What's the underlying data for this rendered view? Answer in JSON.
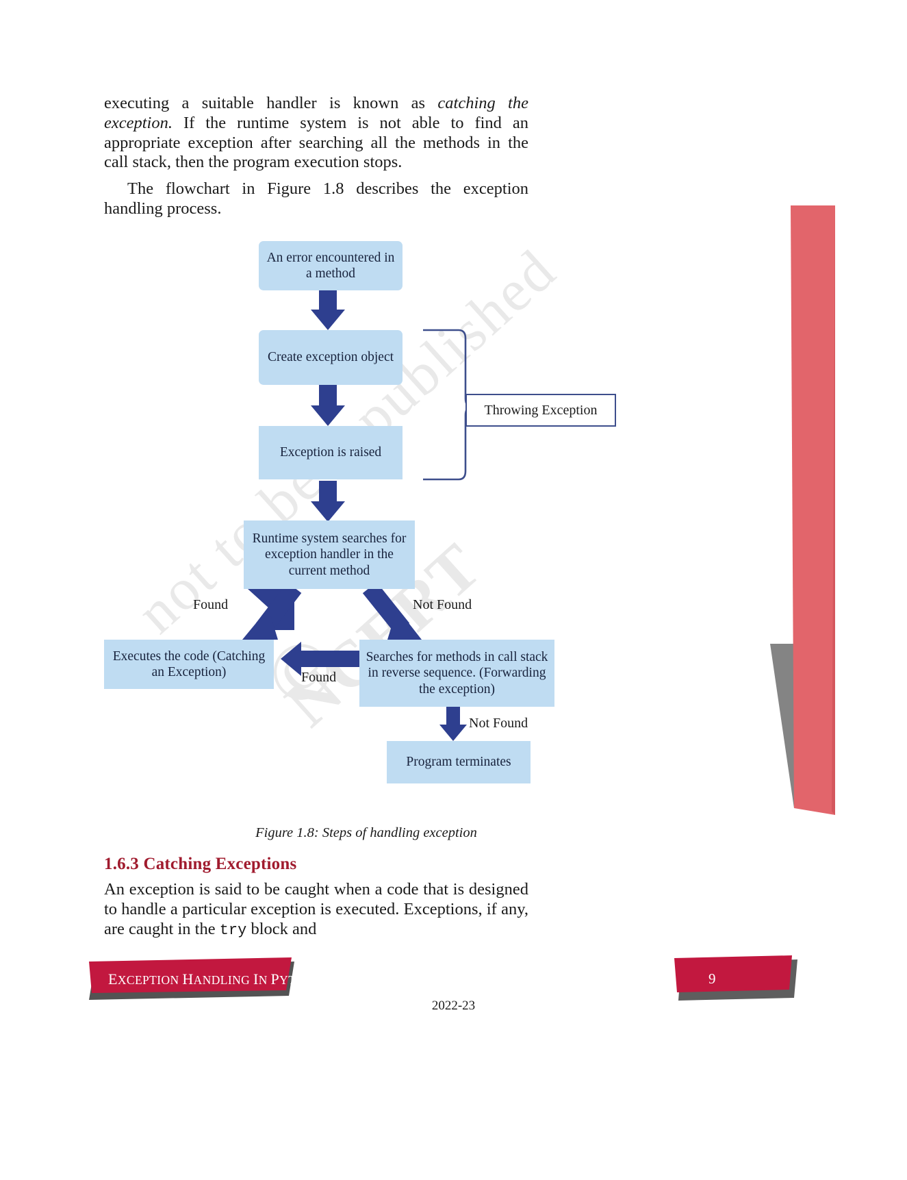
{
  "page": {
    "number": "9",
    "year_footer": "2022-23",
    "chapter_footer": "Exception Handling in Python"
  },
  "paragraphs": {
    "p1_part1": "executing a suitable handler is known as ",
    "p1_italic": "catching the exception.",
    "p1_part2": " If the runtime system is not able to find an appropriate exception after searching all the methods in the call stack, then the program execution stops.",
    "p2": "The flowchart in Figure 1.8 describes the exception handling process.",
    "p3_part1": "An exception is said to be caught when a code that is designed to handle a particular exception is executed. Exceptions, if any, are caught in the ",
    "p3_mono": "try",
    "p3_part2": " block and"
  },
  "section_heading": "1.6.3 Catching Exceptions",
  "figure": {
    "caption": "Figure 1.8:  Steps of handling exception",
    "nodes": [
      {
        "id": "n1",
        "text": "An error encountered in a method"
      },
      {
        "id": "n2",
        "text": "Create exception object"
      },
      {
        "id": "n3",
        "text": "Exception is raised"
      },
      {
        "id": "n4",
        "text": "Runtime system searches for exception handler in the current method"
      },
      {
        "id": "n5",
        "text": "Executes the code (Catching an Exception)"
      },
      {
        "id": "n6",
        "text": "Searches for methods in call stack in reverse sequence. (Forwarding the exception)"
      },
      {
        "id": "n7",
        "text": "Program terminates"
      }
    ],
    "callout": "Throwing Exception",
    "edge_labels": [
      {
        "id": "e1",
        "text": "Found"
      },
      {
        "id": "e2",
        "text": "Not Found"
      },
      {
        "id": "e3",
        "text": "Found"
      },
      {
        "id": "e4",
        "text": "Not Found"
      }
    ]
  },
  "watermark": {
    "line1": "not to be republished",
    "line2": "NCERT",
    "line3": "©"
  },
  "colors": {
    "node_fill": "#bfdcf2",
    "arrow": "#2e3f8f",
    "bracket": "#3d4e8c",
    "heading": "#a01b2e",
    "banner": "#c2183f",
    "ribbon": "#e2656b"
  }
}
